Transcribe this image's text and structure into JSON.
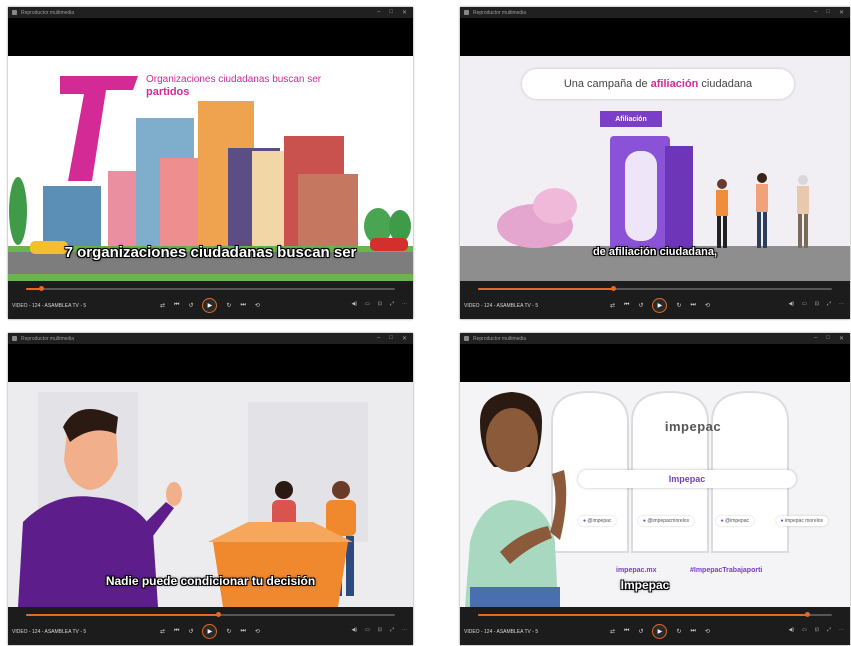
{
  "player": {
    "panel1": {
      "window_title": "Reproductor multimedia",
      "video_label": "VIDEO - 124 - ASAMBLEA TV - 5",
      "progress": 0.04,
      "title_line1": "Organizaciones ciudadanas buscan ser",
      "title_line2": "partidos",
      "big_number": "7",
      "subtitle": "7 organizaciones ciudadanas buscan ser"
    },
    "panel2": {
      "window_title": "Reproductor multimedia",
      "video_label": "VIDEO - 124 - ASAMBLEA TV - 5",
      "progress": 0.38,
      "banner_prefix": "Una campaña de ",
      "banner_highlight": "afiliación",
      "banner_suffix": " ciudadana",
      "sign": "Afiliación",
      "subtitle": "de afiliación ciudadana,"
    },
    "panel3": {
      "window_title": "Reproductor multimedia",
      "video_label": "VIDEO - 124 - ASAMBLEA TV - 5",
      "progress": 0.52,
      "subtitle": "Nadie puede condicionar tu decisión"
    },
    "panel4": {
      "window_title": "Reproductor multimedia",
      "video_label": "VIDEO - 124 - ASAMBLEA TV - 5",
      "progress": 0.93,
      "logo": "impepac",
      "bar_label": "Impepac",
      "social1": "@impepac",
      "social2": "@impepacmorelos",
      "social3": "@impepac",
      "social4": "impepac morelos",
      "website": "impepac.mx",
      "hashtag": "#ImpepacTrabajaporti",
      "subtitle": "Impepac"
    }
  },
  "colors": {
    "accent": "#e06a26",
    "magenta": "#d42a96",
    "purple": "#7a3ec8"
  }
}
